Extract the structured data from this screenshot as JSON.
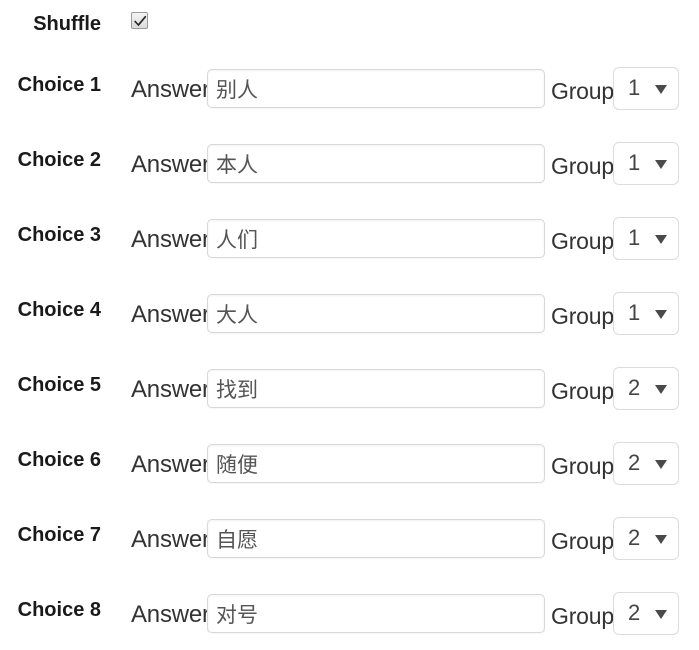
{
  "shuffle": {
    "label": "Shuffle",
    "checked": true
  },
  "labels": {
    "answer": "Answer",
    "group": "Group"
  },
  "colors": {
    "text": "#1a1a1a",
    "caption": "#333333",
    "input_text": "#555555",
    "border": "#d8d8d8",
    "background": "#ffffff"
  },
  "group_options": [
    "1",
    "2"
  ],
  "choices": [
    {
      "label": "Choice 1",
      "answer": "别人",
      "group": "1"
    },
    {
      "label": "Choice 2",
      "answer": "本人",
      "group": "1"
    },
    {
      "label": "Choice 3",
      "answer": "人们",
      "group": "1"
    },
    {
      "label": "Choice 4",
      "answer": "大人",
      "group": "1"
    },
    {
      "label": "Choice 5",
      "answer": "找到",
      "group": "2"
    },
    {
      "label": "Choice 6",
      "answer": "随便",
      "group": "2"
    },
    {
      "label": "Choice 7",
      "answer": "自愿",
      "group": "2"
    },
    {
      "label": "Choice 8",
      "answer": "对号",
      "group": "2"
    }
  ]
}
